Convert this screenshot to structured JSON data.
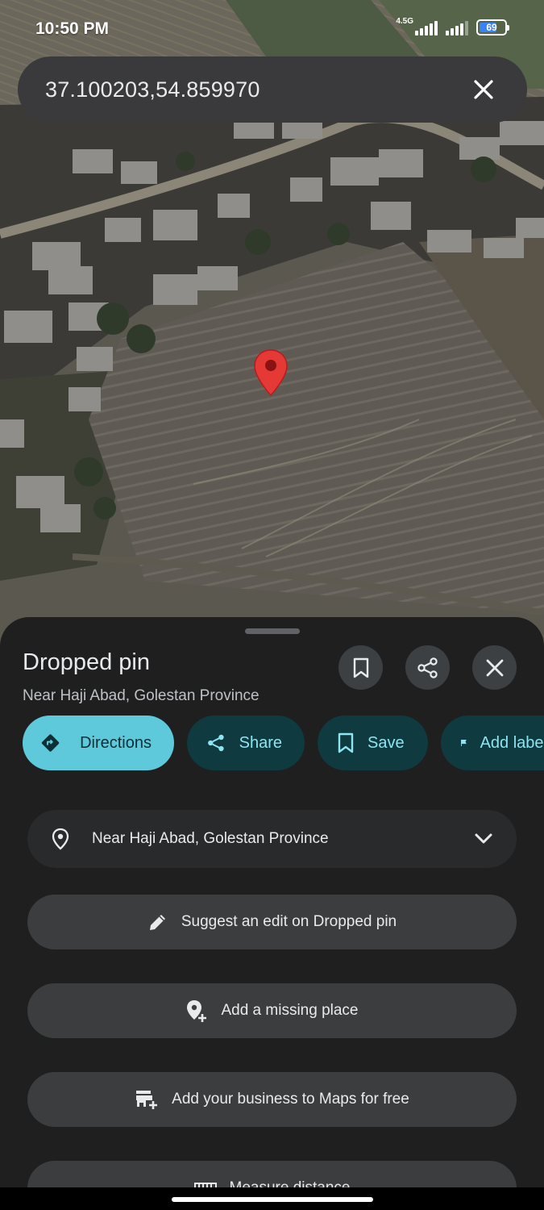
{
  "status_bar": {
    "time": "10:50 PM",
    "network": "4.5G",
    "battery": "69",
    "battery_fraction": 0.69
  },
  "search": {
    "value": "37.100203,54.859970",
    "clear_icon": "close-icon"
  },
  "map": {
    "pin_icon": "map-pin-icon",
    "pin_color": "#e53935"
  },
  "sheet": {
    "title": "Dropped pin",
    "subtitle": "Near Haji Abad, Golestan Province",
    "header_buttons": [
      "bookmark-icon",
      "share-icon",
      "close-icon"
    ],
    "chips": [
      {
        "label": "Directions",
        "icon": "directions-icon"
      },
      {
        "label": "Share",
        "icon": "share-icon"
      },
      {
        "label": "Save",
        "icon": "bookmark-icon"
      },
      {
        "label": "Add label",
        "icon": "flag-icon"
      }
    ],
    "address": {
      "text": "Near Haji Abad, Golestan Province",
      "icon": "location-pin-icon",
      "expand_icon": "chevron-down-icon"
    },
    "actions": [
      {
        "label": "Suggest an edit on Dropped pin",
        "icon": "pencil-icon"
      },
      {
        "label": "Add a missing place",
        "icon": "add-location-icon"
      },
      {
        "label": "Add your business to Maps for free",
        "icon": "add-business-icon"
      },
      {
        "label": "Measure distance",
        "icon": "ruler-icon"
      }
    ]
  },
  "colors": {
    "accent": "#5ec9db",
    "chip_bg": "#0e3a40",
    "chip_text": "#8ee4f0",
    "sheet_bg": "#1f1f1f"
  }
}
